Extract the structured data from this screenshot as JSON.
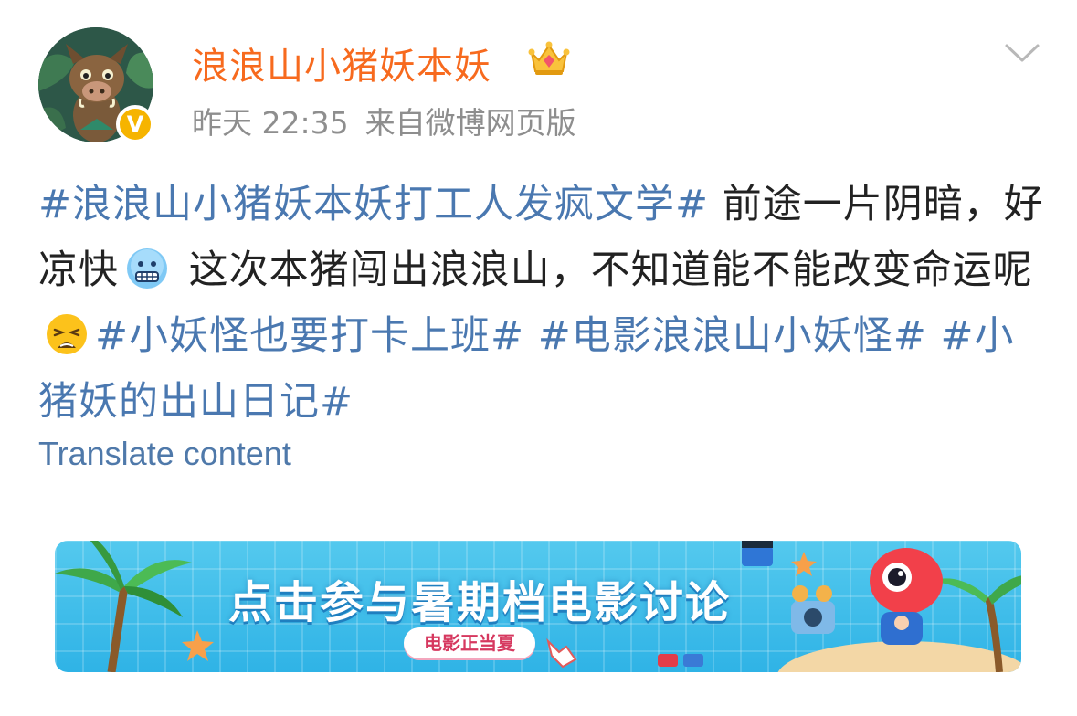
{
  "post": {
    "username": "浪浪山小猪妖本妖",
    "meta": {
      "time": "昨天 22:35",
      "source": "来自微博网页版"
    },
    "content": {
      "topic1": "#浪浪山小猪妖本妖打工人发疯文学#",
      "text1": " 前途一片阴暗，好凉快",
      "text2": " 这次本猪闯出浪浪山，不知道能不能改变命运呢",
      "topic2": "#小妖怪也要打卡上班#",
      "topic3": "#电影浪浪山小妖怪#",
      "topic4": "#小猪妖的出山日记#"
    },
    "translate_label": "Translate content"
  },
  "banner": {
    "title": "点击参与暑期档电影讨论",
    "pill": "电影正当夏"
  },
  "colors": {
    "username": "#f76a1e",
    "topic": "#4a78b0",
    "meta": "#8e8e8e",
    "verified": "#f6b400",
    "banner_bg": "#3dbdea"
  },
  "icons": {
    "verified": "verified-badge-icon",
    "member": "crown-icon",
    "more": "chevron-down-icon",
    "emoji1": "freezing-face-icon",
    "emoji2": "weary-face-icon"
  }
}
